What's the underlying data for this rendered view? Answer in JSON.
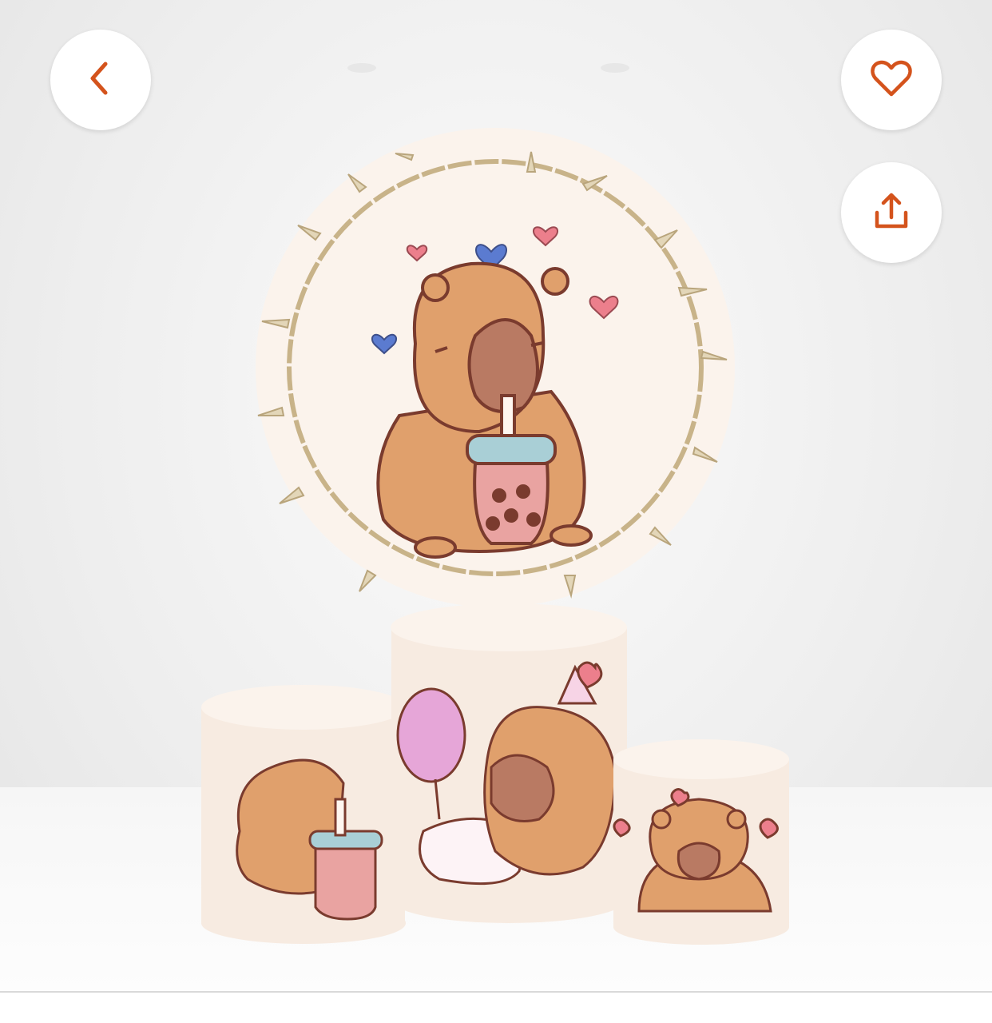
{
  "toolbar": {
    "back_icon": "chevron-left-icon",
    "favorite_icon": "heart-outline-icon",
    "share_icon": "share-upload-icon",
    "accent_color": "#d4531c"
  },
  "product_image": {
    "subject": "capybara-backdrop-and-cylinder-covers",
    "palette": {
      "backdrop": "#fbf3ec",
      "capybara": "#e0a06c",
      "capybara_dark": "#7a3b2e",
      "snout": "#b97a63",
      "bamboo": "#c8b389",
      "heart_pink": "#ec7f8c",
      "heart_blue": "#5b7bd0"
    }
  }
}
